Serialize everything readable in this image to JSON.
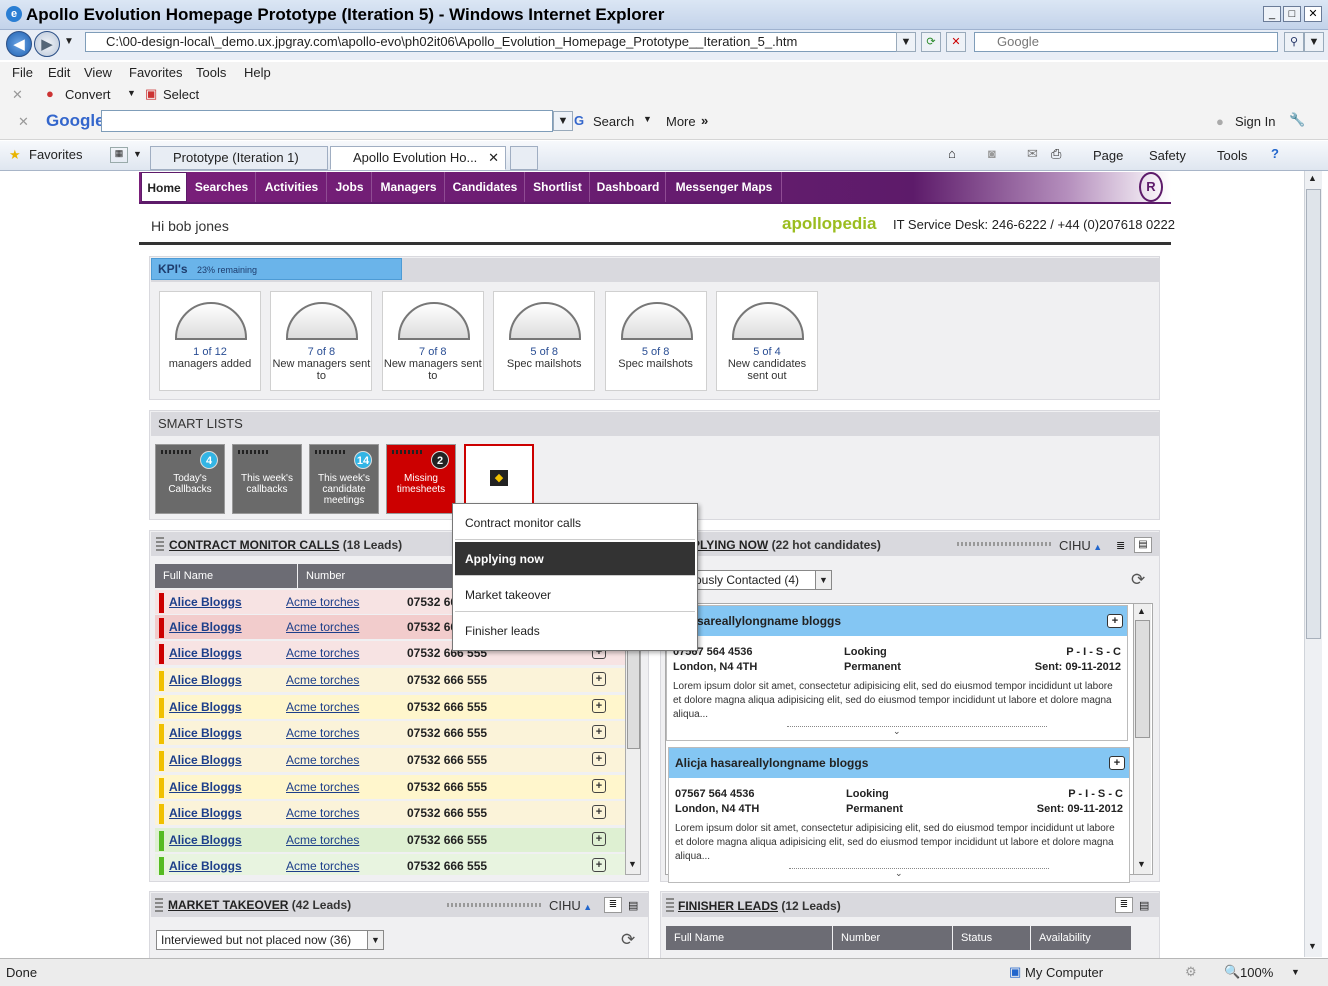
{
  "browser": {
    "title": "Apollo Evolution Homepage Prototype (Iteration 5) - Windows Internet Explorer",
    "url": "C:\\00-design-local\\_demo.ux.jpgray.com\\apollo-evo\\ph02it06\\Apollo_Evolution_Homepage_Prototype__Iteration_5_.htm",
    "search_placeholder": "Google",
    "menu": [
      "File",
      "Edit",
      "View",
      "Favorites",
      "Tools",
      "Help"
    ],
    "convert_label": "Convert",
    "select_label": "Select",
    "google_search_label": "Search",
    "google_more_label": "More",
    "sign_in_label": "Sign In",
    "favorites_label": "Favorites",
    "tabs": [
      "Prototype (Iteration 1)",
      "Apollo Evolution Ho..."
    ],
    "cmd": [
      "Page",
      "Safety",
      "Tools"
    ],
    "status_text": "Done",
    "zone": "My Computer",
    "zoom": "100%"
  },
  "app": {
    "nav": [
      "Home",
      "Searches",
      "Activities",
      "Jobs",
      "Managers",
      "Candidates",
      "Shortlist",
      "Dashboard",
      "Messenger Maps"
    ],
    "greeting": "Hi bob jones",
    "logo": "apollopedia",
    "desk": "IT Service Desk: 246-6222 / +44 (0)207618 0222",
    "kpi_title": "KPI's",
    "kpi_remaining": "23% remaining",
    "kpi_remaining_fraction": 0.23,
    "kpis": [
      {
        "top": "1 of 12",
        "label": "managers added"
      },
      {
        "top": "7 of 8",
        "label": "New managers sent to"
      },
      {
        "top": "7 of 8",
        "label": "New managers sent to"
      },
      {
        "top": "5 of 8",
        "label": "Spec mailshots"
      },
      {
        "top": "5 of 8",
        "label": "Spec mailshots"
      },
      {
        "top": "5 of 4",
        "label": "New candidates sent out"
      }
    ],
    "smart_lists_title": "SMART LISTS",
    "smart_tiles": [
      {
        "label": "Today's Callbacks",
        "count": "4"
      },
      {
        "label": "This week's callbacks",
        "count": ""
      },
      {
        "label": "This week's candidate meetings",
        "count": "14"
      },
      {
        "label": "Missing timesheets",
        "count": "2"
      }
    ],
    "popup": [
      "Contract monitor calls",
      "Applying now",
      "Market takeover",
      "Finisher leads"
    ],
    "contract": {
      "title": "CONTRACT MONITOR CALLS",
      "count": "(18 Leads)",
      "cols": [
        "Full Name",
        "Number"
      ],
      "rows": [
        {
          "name": "Alice Bloggs",
          "company": "Acme torches",
          "phone": "07532 66",
          "color": "#cc0000",
          "bg": "#f7e3e3"
        },
        {
          "name": "Alice Bloggs",
          "company": "Acme torches",
          "phone": "07532 66",
          "color": "#cc0000",
          "bg": "#f2cccc"
        },
        {
          "name": "Alice Bloggs",
          "company": "Acme torches",
          "phone": "07532 666 555",
          "color": "#cc0000",
          "bg": "#f7e3e3"
        },
        {
          "name": "Alice Bloggs",
          "company": "Acme torches",
          "phone": "07532 666 555",
          "color": "#f0c000",
          "bg": "#fbf3d9"
        },
        {
          "name": "Alice Bloggs",
          "company": "Acme torches",
          "phone": "07532 666 555",
          "color": "#f0c000",
          "bg": "#fff6cc"
        },
        {
          "name": "Alice Bloggs",
          "company": "Acme torches",
          "phone": "07532 666 555",
          "color": "#f0c000",
          "bg": "#fbf3d9"
        },
        {
          "name": "Alice Bloggs",
          "company": "Acme torches",
          "phone": "07532 666 555",
          "color": "#f0c000",
          "bg": "#fbf3d9"
        },
        {
          "name": "Alice Bloggs",
          "company": "Acme torches",
          "phone": "07532 666 555",
          "color": "#f0c000",
          "bg": "#fff6cc"
        },
        {
          "name": "Alice Bloggs",
          "company": "Acme torches",
          "phone": "07532 666 555",
          "color": "#f0c000",
          "bg": "#fbf3d9"
        },
        {
          "name": "Alice Bloggs",
          "company": "Acme torches",
          "phone": "07532 666 555",
          "color": "#55bb22",
          "bg": "#def0d2"
        },
        {
          "name": "Alice Bloggs",
          "company": "Acme torches",
          "phone": "07532 666 555",
          "color": "#55bb22",
          "bg": "#e8f4e0"
        }
      ]
    },
    "applying": {
      "title": "PLYING NOW",
      "count": "(22 hot candidates)",
      "sort": "CIHU",
      "filter": "ously Contacted (4)",
      "cards": [
        {
          "name": "a hasareallylongname bloggs",
          "phone": "07567 564 4536",
          "loc": "London, N4 4TH",
          "s1": "Looking",
          "s2": "Permanent",
          "pisc": "P - I - S - C",
          "sent": "Sent: 09-11-2012",
          "lorem": "Lorem ipsum dolor sit amet, consectetur adipisicing elit, sed do eiusmod tempor incididunt ut labore et dolore magna aliqua adipisicing elit, sed do eiusmod tempor incididunt ut labore et dolore magna aliqua..."
        },
        {
          "name": "Alicja hasareallylongname bloggs",
          "phone": "07567 564 4536",
          "loc": "London, N4 4TH",
          "s1": "Looking",
          "s2": "Permanent",
          "pisc": "P - I - S - C",
          "sent": "Sent: 09-11-2012",
          "lorem": "Lorem ipsum dolor sit amet, consectetur adipisicing elit, sed do eiusmod tempor incididunt ut labore et dolore magna aliqua adipisicing elit, sed do eiusmod tempor incididunt ut labore et dolore magna aliqua..."
        }
      ]
    },
    "market": {
      "title": "MARKET TAKEOVER",
      "count": "(42 Leads)",
      "sort": "CIHU",
      "filter": "Interviewed but not placed now (36)"
    },
    "finisher": {
      "title": "FINISHER LEADS",
      "count": "(12 Leads)",
      "cols": [
        "Full Name",
        "Number",
        "Status",
        "Availability"
      ]
    }
  }
}
